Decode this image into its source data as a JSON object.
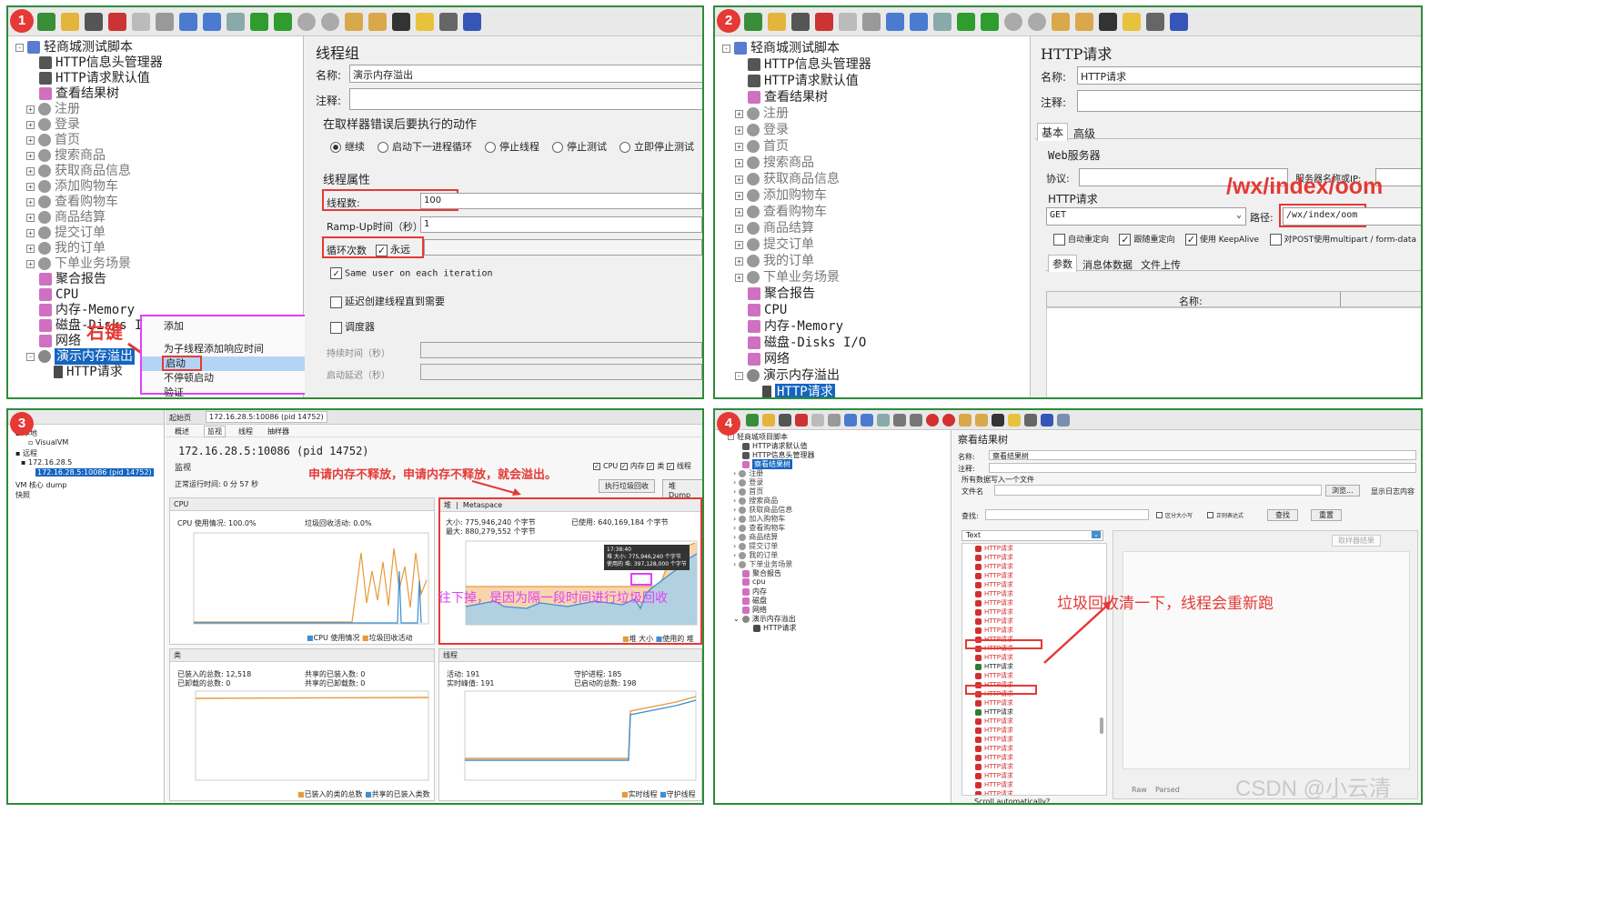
{
  "badges": [
    "1",
    "2",
    "3",
    "4"
  ],
  "colors": {
    "frame": "#2e8b3a",
    "red": "#e53935",
    "magenta": "#e040fb",
    "select": "#1565c0",
    "fail": "#d32f2f",
    "pass": "#2e7d32"
  },
  "p1": {
    "tree": [
      "轻商城测试脚本",
      "HTTP信息头管理器",
      "HTTP请求默认值",
      "查看结果树",
      "注册",
      "登录",
      "首页",
      "搜索商品",
      "获取商品信息",
      "添加购物车",
      "查看购物车",
      "商品结算",
      "提交订单",
      "我的订单",
      "下单业务场景",
      "聚合报告",
      "CPU",
      "内存-Memory",
      "磁盘-Disks I/O",
      "网络",
      "演示内存溢出",
      "HTTP请求"
    ],
    "right_click": "右键",
    "menu": [
      "添加",
      "为子线程添加响应时间",
      "启动",
      "不停顿启动",
      "验证"
    ],
    "form": {
      "title": "线程组",
      "name_label": "名称:",
      "name_value": "演示内存溢出",
      "comment_label": "注释:",
      "error_title": "在取样器错误后要执行的动作",
      "radios": [
        "继续",
        "启动下一进程循环",
        "停止线程",
        "停止测试",
        "立即停止测试"
      ],
      "props_title": "线程属性",
      "threads_label": "线程数:",
      "threads_value": "100",
      "rampup_label": "Ramp-Up时间（秒）:",
      "rampup_value": "1",
      "loop_label": "循环次数",
      "loop_forever": "永远",
      "same_user": "Same user on each iteration",
      "delay": "延迟创建线程直到需要",
      "scheduler": "调度器",
      "duration": "持续时间（秒）",
      "startup_delay": "启动延迟（秒）"
    }
  },
  "p2": {
    "tree": [
      "轻商城测试脚本",
      "HTTP信息头管理器",
      "HTTP请求默认值",
      "查看结果树",
      "注册",
      "登录",
      "首页",
      "搜索商品",
      "获取商品信息",
      "添加购物车",
      "查看购物车",
      "商品结算",
      "提交订单",
      "我的订单",
      "下单业务场景",
      "聚合报告",
      "CPU",
      "内存-Memory",
      "磁盘-Disks I/O",
      "网络",
      "演示内存溢出",
      "HTTP请求"
    ],
    "form": {
      "title": "HTTP请求",
      "name_label": "名称:",
      "name_value": "HTTP请求",
      "comment_label": "注释:",
      "tabs": [
        "基本",
        "高级"
      ],
      "web_server": "Web服务器",
      "protocol": "协议:",
      "server": "服务器名称或IP:",
      "http_req": "HTTP请求",
      "method": "GET",
      "path_label": "路径:",
      "path_value": "/wx/index/oom",
      "checkboxes": [
        "自动重定向",
        "跟随重定向",
        "使用 KeepAlive",
        "对POST使用multipart / form-data"
      ],
      "subtabs": [
        "参数",
        "消息体数据",
        "文件上传"
      ],
      "col_name": "名称:"
    },
    "annotation": "/wx/index/oom"
  },
  "p3": {
    "left_tree": [
      "本地",
      "VisualVM",
      "远程",
      "172.16.28.5",
      "172.16.28.5:10086 (pid 14752)",
      "VM 核心 dump",
      "快照"
    ],
    "tabs": [
      "起始页",
      "172.16.28.5:10086 (pid 14752)"
    ],
    "subtabs": [
      "概述",
      "监视",
      "线程",
      "抽样器"
    ],
    "host": "172.16.28.5:10086 (pid 14752)",
    "monitor": "监视",
    "uptime": "正常运行时间: 0 分 57 秒",
    "checks": [
      "CPU",
      "内存",
      "类",
      "线程"
    ],
    "buttons": [
      "执行垃圾回收",
      "堆 Dump"
    ],
    "annotation_top": "申请内存不释放，申请内存不释放，就会溢出。",
    "annotation_mid": "往下掉，是因为隔一段时间进行垃圾回收",
    "cpu": {
      "title": "CPU",
      "usage": "CPU 使用情况: 100.0%",
      "gc": "垃圾回收活动: 0.0%",
      "legend": [
        "CPU 使用情况",
        "垃圾回收活动"
      ]
    },
    "heap": {
      "tabs": [
        "堆",
        "Metaspace"
      ],
      "size": "大小: 775,946,240 个字节",
      "max": "最大: 880,279,552 个字节",
      "used": "已使用: 640,169,184 个字节",
      "tooltip": [
        "17:38:40",
        "堆 大小: 775,946,240 个字节",
        "使用的 堆: 397,128,000 个字节"
      ],
      "legend": [
        "堆 大小",
        "使用的 堆"
      ]
    },
    "classes": {
      "title": "类",
      "loaded": "已装入的总数: 12,518",
      "unloaded": "已卸载的总数: 0",
      "shared_loaded": "共享的已装入数: 0",
      "shared_unloaded": "共享的已卸载数: 0",
      "legend": [
        "已装入的类的总数",
        "共享的已装入类数"
      ]
    },
    "threads": {
      "title": "线程",
      "live": "活动: 191",
      "peak": "实时峰值: 191",
      "daemon": "守护进程: 185",
      "started": "已启动的总数: 198",
      "legend": [
        "实时线程",
        "守护线程"
      ]
    },
    "time_labels": [
      "下午5:32",
      "下午5:34",
      "下午5:36",
      "下午5:38"
    ]
  },
  "p4": {
    "tree": [
      "轻商城项目脚本",
      "HTTP请求默认值",
      "HTTP信息头管理器",
      "察看结果树",
      "注册",
      "登录",
      "首页",
      "搜索商品",
      "获取商品信息",
      "加入购物车",
      "查看购物车",
      "商品结算",
      "提交订单",
      "我的订单",
      "下单业务场景",
      "聚合报告",
      "cpu",
      "内存",
      "磁盘",
      "网络",
      "演示内存溢出",
      "HTTP请求"
    ],
    "form": {
      "title": "察看结果树",
      "name_label": "名称:",
      "name_value": "察看结果树",
      "comment_label": "注释:",
      "write_all": "所有数据写入一个文件",
      "filename": "文件名",
      "browse": "浏览...",
      "log_only": "显示日志内容",
      "search_label": "查找:",
      "case": "区分大小写",
      "regex": "正则表达式",
      "find": "查找",
      "reset": "重置",
      "text_select": "Text",
      "sampler": "HTTP请求",
      "scroll": "Scroll automatically?",
      "raw": "Raw",
      "parsed": "Parsed",
      "no_result": "取样器结果"
    },
    "annotation": "垃圾回收清一下，线程会重新跑"
  },
  "watermark": "CSDN @小云清"
}
